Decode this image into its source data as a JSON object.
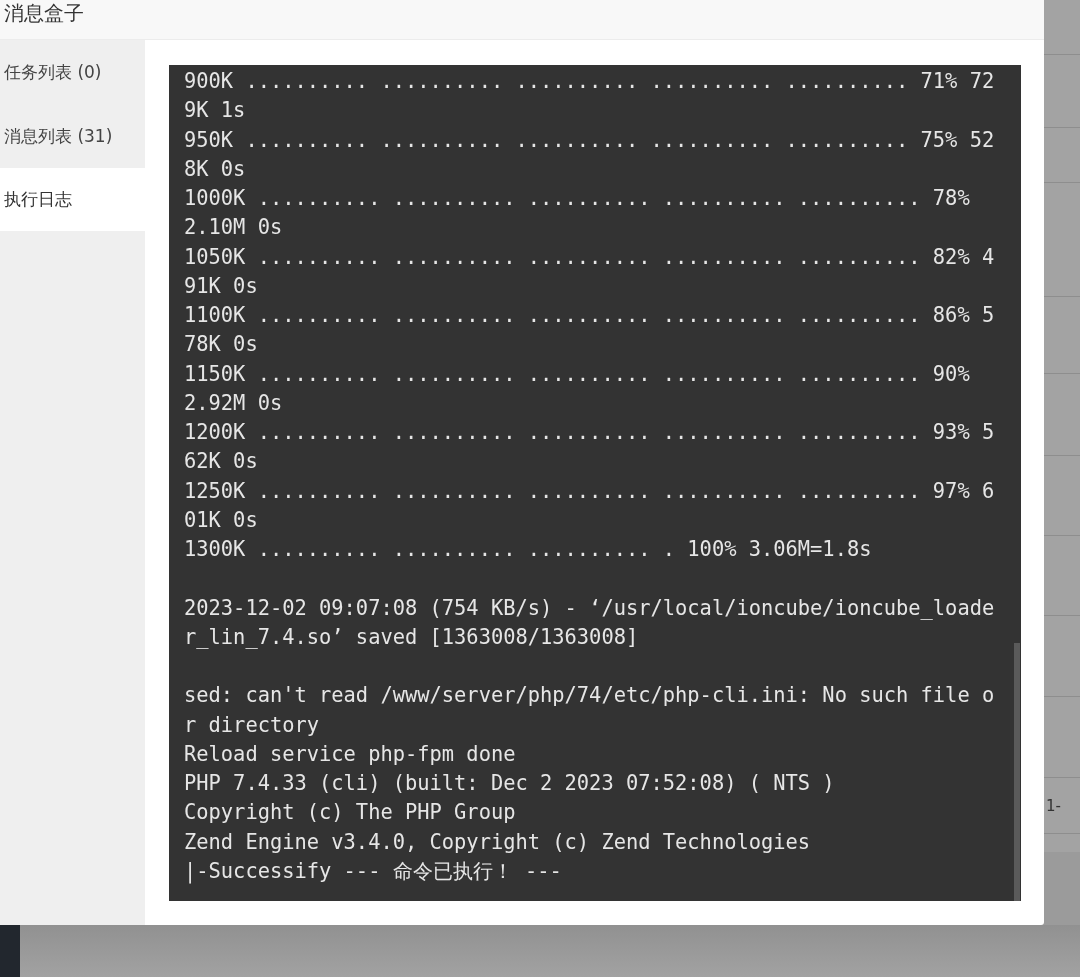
{
  "window": {
    "title": "消息盒子"
  },
  "tabs": [
    {
      "label": "任务列表 (0)",
      "selected": false
    },
    {
      "label": "消息列表 (31)",
      "selected": false
    },
    {
      "label": "执行日志",
      "selected": true
    }
  ],
  "log": {
    "blocks": [
      {
        "lines": [
          "900K .......... .......... .......... .......... .......... 71% 72",
          "9K 1s",
          "950K .......... .......... .......... .......... .......... 75% 52",
          "8K 0s",
          "1000K .......... .......... .......... .......... .......... 78%",
          "2.10M 0s",
          "1050K .......... .......... .......... .......... .......... 82% 4",
          "91K 0s",
          "1100K .......... .......... .......... .......... .......... 86% 5",
          "78K 0s",
          "1150K .......... .......... .......... .......... .......... 90%",
          "2.92M 0s",
          "1200K .......... .......... .......... .......... .......... 93% 5",
          "62K 0s",
          "1250K .......... .......... .......... .......... .......... 97% 6",
          "01K 0s",
          "1300K .......... .......... .......... . 100% 3.06M=1.8s"
        ]
      },
      {
        "lines": [
          "2023-12-02 09:07:08 (754 KB/s) - ‘/usr/local/ioncube/ioncube_loade",
          "r_lin_7.4.so’ saved [1363008/1363008]"
        ]
      },
      {
        "lines": [
          "sed: can't read /www/server/php/74/etc/php-cli.ini: No such file o",
          "r directory",
          "Reload service php-fpm done",
          "PHP 7.4.33 (cli) (built: Dec 2 2023 07:52:08) ( NTS )",
          "Copyright (c) The PHP Group",
          "Zend Engine v3.4.0, Copyright (c) Zend Technologies",
          "|-Successify --- 命令已执行！ ---"
        ]
      }
    ]
  },
  "background_page": {
    "pager_text": "1-"
  }
}
